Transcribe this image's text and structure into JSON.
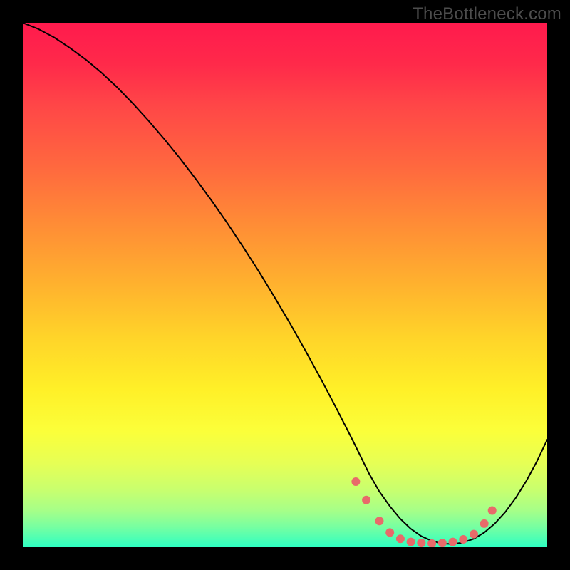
{
  "watermark": "TheBottleneck.com",
  "chart_data": {
    "type": "line",
    "title": "",
    "xlabel": "",
    "ylabel": "",
    "xlim": [
      0,
      100
    ],
    "ylim": [
      0,
      100
    ],
    "grid": false,
    "series": [
      {
        "name": "curve",
        "color": "#000000",
        "x": [
          0,
          3,
          6,
          9,
          12,
          15,
          18,
          21,
          24,
          27,
          30,
          33,
          36,
          39,
          42,
          45,
          48,
          51,
          54,
          57,
          60,
          63,
          66,
          68,
          70,
          72,
          74,
          76,
          78,
          80,
          82,
          84,
          86,
          88,
          90,
          92,
          94,
          96,
          98,
          100
        ],
        "y": [
          100,
          98.8,
          97.2,
          95.2,
          93.0,
          90.5,
          87.7,
          84.6,
          81.3,
          77.8,
          74.1,
          70.2,
          66.1,
          61.8,
          57.3,
          52.6,
          47.7,
          42.6,
          37.3,
          31.8,
          26.1,
          20.2,
          14.1,
          10.6,
          7.8,
          5.4,
          3.5,
          2.1,
          1.2,
          0.7,
          0.6,
          0.9,
          1.6,
          2.8,
          4.5,
          6.7,
          9.4,
          12.6,
          16.3,
          20.5
        ]
      }
    ],
    "markers": [
      {
        "x": 63.5,
        "y": 12.5
      },
      {
        "x": 65.5,
        "y": 9.0
      },
      {
        "x": 68.0,
        "y": 5.0
      },
      {
        "x": 70.0,
        "y": 2.8
      },
      {
        "x": 72.0,
        "y": 1.6
      },
      {
        "x": 74.0,
        "y": 1.0
      },
      {
        "x": 76.0,
        "y": 0.8
      },
      {
        "x": 78.0,
        "y": 0.7
      },
      {
        "x": 80.0,
        "y": 0.8
      },
      {
        "x": 82.0,
        "y": 1.0
      },
      {
        "x": 84.0,
        "y": 1.5
      },
      {
        "x": 86.0,
        "y": 2.5
      },
      {
        "x": 88.0,
        "y": 4.5
      },
      {
        "x": 89.5,
        "y": 7.0
      }
    ],
    "marker_color": "#e86a6a",
    "marker_radius": 6
  }
}
